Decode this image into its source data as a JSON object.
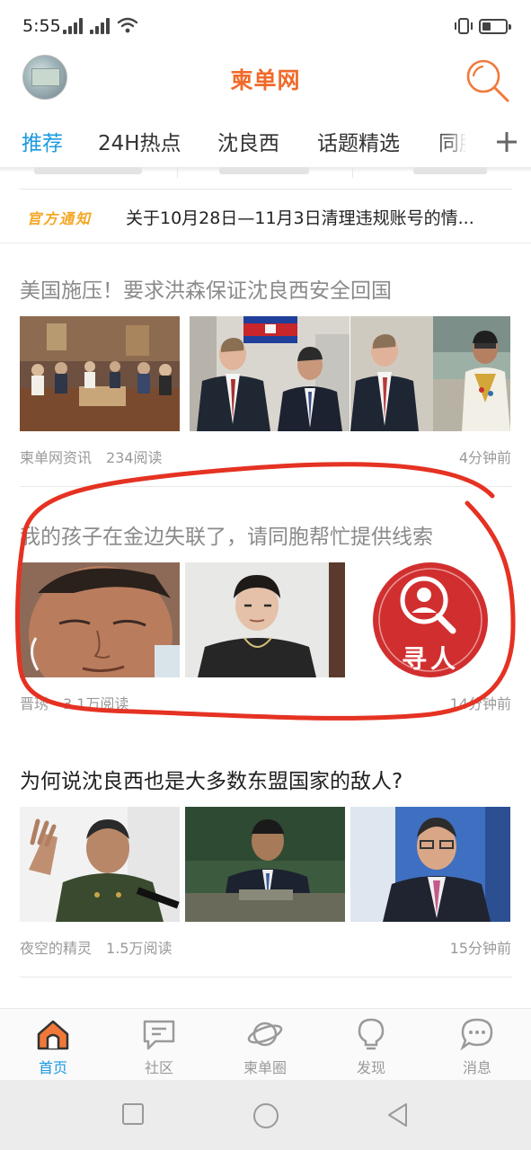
{
  "status_bar": {
    "time": "5:55"
  },
  "header": {
    "title": "柬单网"
  },
  "tabs": [
    {
      "label": "推荐",
      "active": true
    },
    {
      "label": "24H热点",
      "active": false
    },
    {
      "label": "沈良西",
      "active": false
    },
    {
      "label": "话题精选",
      "active": false
    },
    {
      "label": "同胞",
      "active": false
    }
  ],
  "notice": {
    "badge": "官方通知",
    "text": "关于10月28日—11月3日清理违规账号的情..."
  },
  "articles": [
    {
      "title": "美国施压！要求洪森保证沈良西安全回国",
      "author": "柬单网资讯",
      "reads": "234阅读",
      "time": "4分钟前",
      "read": true
    },
    {
      "title": "我的孩子在金边失联了，请同胞帮忙提供线索",
      "author": "晋琇",
      "reads": "3.1万阅读",
      "time": "14分钟前",
      "read": true,
      "badge_text": "寻人"
    },
    {
      "title": "为何说沈良西也是大多数东盟国家的敌人?",
      "author": "夜空的精灵",
      "reads": "1.5万阅读",
      "time": "15分钟前",
      "read": false
    }
  ],
  "bottom_nav": [
    {
      "label": "首页",
      "icon": "home-icon",
      "active": true
    },
    {
      "label": "社区",
      "icon": "chat-edit-icon",
      "active": false
    },
    {
      "label": "柬单圈",
      "icon": "planet-icon",
      "active": false
    },
    {
      "label": "发现",
      "icon": "lightbulb-icon",
      "active": false
    },
    {
      "label": "消息",
      "icon": "message-icon",
      "active": false
    }
  ],
  "colors": {
    "brand": "#f06a2a",
    "active": "#1b9ae0",
    "notice": "#f5a623",
    "annotation": "#e53222"
  }
}
